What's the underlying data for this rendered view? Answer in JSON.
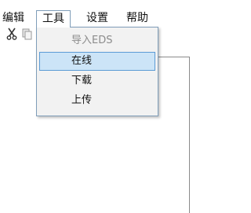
{
  "menubar": {
    "items": [
      {
        "label": "编辑"
      },
      {
        "label": "工具"
      },
      {
        "label": "设置"
      },
      {
        "label": "帮助"
      }
    ]
  },
  "toolbar": {
    "icons": [
      "scissors-icon",
      "copy-icon"
    ]
  },
  "dropdown": {
    "items": [
      {
        "label": "导入EDS",
        "state": "disabled"
      },
      {
        "label": "在线",
        "state": "selected"
      },
      {
        "label": "下载",
        "state": "normal"
      },
      {
        "label": "上传",
        "state": "normal"
      }
    ]
  },
  "colors": {
    "highlight": "#cce4f7",
    "highlight_border": "#5b9bd5",
    "disabled_text": "#8c8c8c"
  }
}
